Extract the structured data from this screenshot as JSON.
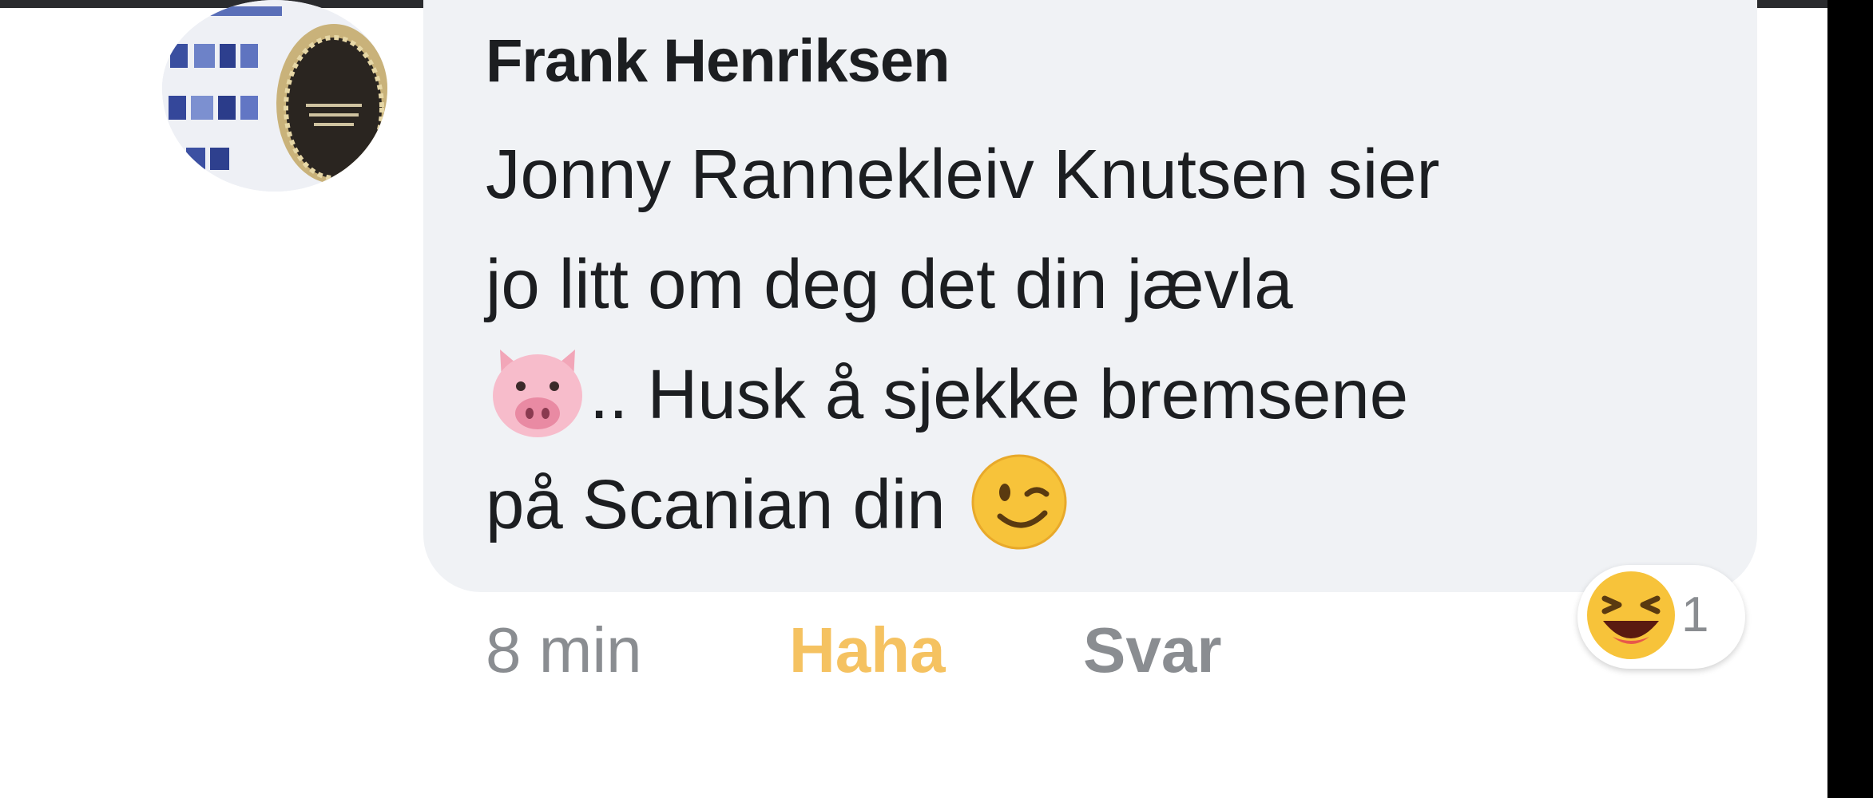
{
  "comment": {
    "author": "Frank Henriksen",
    "text_lines": [
      "Jonny Rannekleiv Knutsen sier",
      "jo litt om deg det din jævla",
      ".. Husk å sjekke bremsene",
      "på Scanian din"
    ],
    "inline_emojis": [
      "pig-face-emoji",
      "winking-face-emoji"
    ]
  },
  "meta": {
    "time": "8 min",
    "my_reaction": "Haha",
    "reply": "Svar"
  },
  "reactions": {
    "emoji": "laughing-face-emoji",
    "count": "1"
  },
  "colors": {
    "bubble": "#f0f2f5",
    "author_text": "#1c1e21",
    "meta_text": "#8a8d91",
    "haha_reaction": "#f5c261"
  }
}
